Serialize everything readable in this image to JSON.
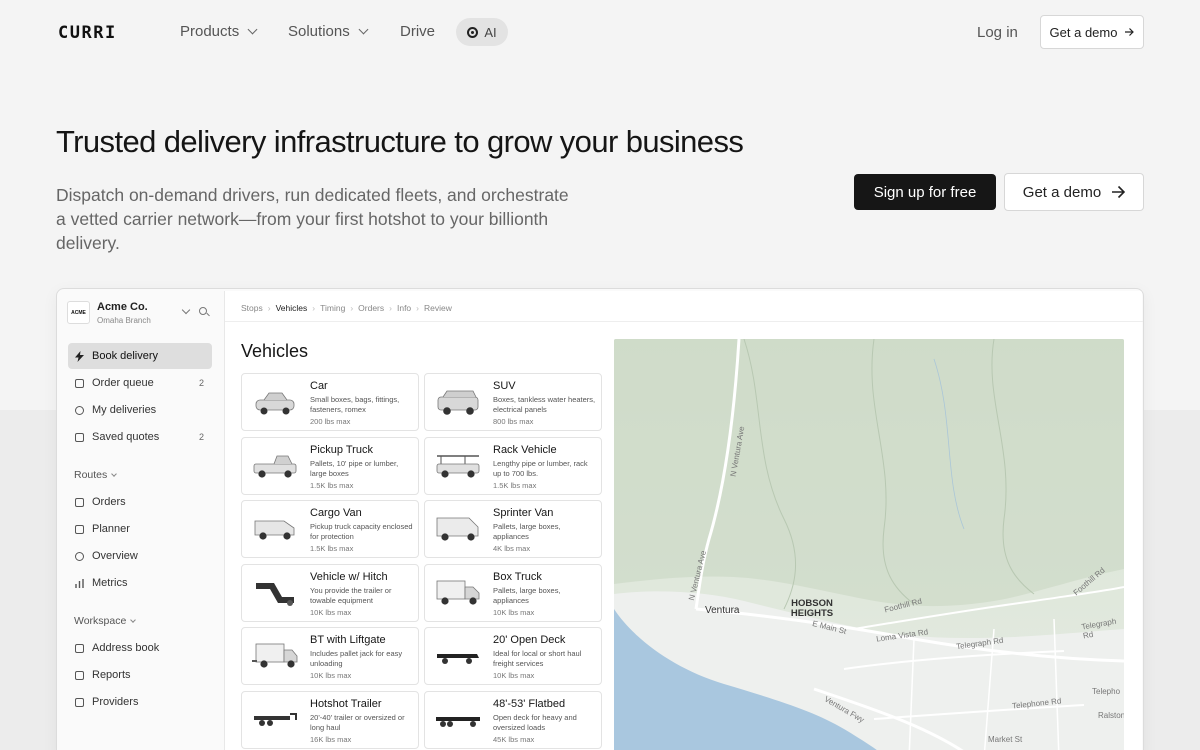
{
  "nav": {
    "logo": "CURRI",
    "items": [
      {
        "label": "Products"
      },
      {
        "label": "Solutions"
      },
      {
        "label": "Drive"
      }
    ],
    "ai_label": "AI",
    "login": "Log in",
    "demo": "Get a demo"
  },
  "hero": {
    "title": "Trusted delivery infrastructure to grow your business",
    "subtitle": "Dispatch on-demand drivers, run dedicated fleets, and orchestrate a vetted carrier network—from your first hotshot to your billionth delivery.",
    "signup": "Sign up for free",
    "demo": "Get a demo"
  },
  "app": {
    "org": {
      "logo": "ACME",
      "name": "Acme Co.",
      "branch": "Omaha Branch"
    },
    "sidebar": {
      "top": [
        {
          "label": "Book delivery",
          "icon": "bolt-icon",
          "badge": ""
        },
        {
          "label": "Order queue",
          "icon": "inbox-icon",
          "badge": "2"
        },
        {
          "label": "My deliveries",
          "icon": "target-icon",
          "badge": ""
        },
        {
          "label": "Saved quotes",
          "icon": "edit-icon",
          "badge": "2"
        }
      ],
      "routes_label": "Routes",
      "routes": [
        {
          "label": "Orders",
          "icon": "cube-icon"
        },
        {
          "label": "Planner",
          "icon": "calendar-icon"
        },
        {
          "label": "Overview",
          "icon": "globe-icon"
        },
        {
          "label": "Metrics",
          "icon": "bar-chart-icon"
        }
      ],
      "workspace_label": "Workspace",
      "workspace": [
        {
          "label": "Address book",
          "icon": "book-icon"
        },
        {
          "label": "Reports",
          "icon": "report-icon"
        },
        {
          "label": "Providers",
          "icon": "box-icon"
        }
      ]
    },
    "breadcrumbs": [
      "Stops",
      "Vehicles",
      "Timing",
      "Orders",
      "Info",
      "Review"
    ],
    "vehicles_title": "Vehicles",
    "vehicles": [
      {
        "name": "Car",
        "desc": "Small boxes, bags, fittings, fasteners, romex",
        "cap": "200 lbs max",
        "kind": "car"
      },
      {
        "name": "SUV",
        "desc": "Boxes, tankless water heaters, electrical panels",
        "cap": "800 lbs max",
        "kind": "suv"
      },
      {
        "name": "Pickup Truck",
        "desc": "Pallets, 10' pipe or lumber, large boxes",
        "cap": "1.5K lbs max",
        "kind": "pickup"
      },
      {
        "name": "Rack Vehicle",
        "desc": "Lengthy pipe or lumber, rack up to 700 lbs.",
        "cap": "1.5K lbs max",
        "kind": "rack"
      },
      {
        "name": "Cargo Van",
        "desc": "Pickup truck capacity enclosed for protection",
        "cap": "1.5K lbs max",
        "kind": "van"
      },
      {
        "name": "Sprinter Van",
        "desc": "Pallets, large boxes, appliances",
        "cap": "4K lbs max",
        "kind": "sprinter"
      },
      {
        "name": "Vehicle w/ Hitch",
        "desc": "You provide the trailer or towable equipment",
        "cap": "10K lbs max",
        "kind": "hitch"
      },
      {
        "name": "Box Truck",
        "desc": "Pallets, large boxes, appliances",
        "cap": "10K lbs max",
        "kind": "boxtruck"
      },
      {
        "name": "BT with Liftgate",
        "desc": "Includes pallet jack for easy unloading",
        "cap": "10K lbs max",
        "kind": "liftgate"
      },
      {
        "name": "20' Open Deck",
        "desc": "Ideal for local or short haul freight services",
        "cap": "10K lbs max",
        "kind": "deck"
      },
      {
        "name": "Hotshot Trailer",
        "desc": "20'-40' trailer or oversized or long haul",
        "cap": "16K lbs max",
        "kind": "hotshot"
      },
      {
        "name": "48'-53' Flatbed",
        "desc": "Open deck for heavy and oversized loads",
        "cap": "45K lbs max",
        "kind": "flatbed"
      }
    ],
    "map": {
      "labels": {
        "ventura": "Ventura",
        "hobson": "HOBSON HEIGHTS",
        "n_ventura_ave_1": "N Ventura Ave",
        "n_ventura_ave_2": "N Ventura Ave",
        "foothill_rd": "Foothill Rd",
        "foothill_rd_2": "Foothill Rd",
        "e_main": "E Main St",
        "loma_vista": "Loma Vista Rd",
        "telegraph_1": "Telegraph Rd",
        "telegraph_2": "Telegraph Rd",
        "telephone_1": "Telephone Rd",
        "telephone_2": "Telepho",
        "ventura_fwy": "Ventura Fwy",
        "market": "Market St",
        "ralston": "Ralston"
      }
    }
  }
}
